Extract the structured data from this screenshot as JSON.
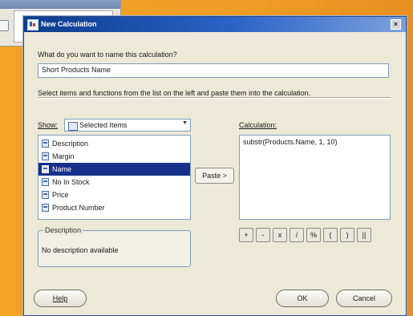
{
  "dialog": {
    "title": "New Calculation",
    "close_glyph": "×",
    "name_prompt": "What do you want to name this calculation?",
    "name_value": "Short Products Name",
    "instructions": "Select items and functions from the list on the left and paste them into the calculation.",
    "show_label": "Show:",
    "show_value": "Selected Items",
    "items": [
      {
        "label": "Description",
        "selected": false
      },
      {
        "label": "Margin",
        "selected": false
      },
      {
        "label": "Name",
        "selected": true
      },
      {
        "label": "No In Stock",
        "selected": false
      },
      {
        "label": "Price",
        "selected": false
      },
      {
        "label": "Product Number",
        "selected": false
      }
    ],
    "paste_label": "Paste >",
    "calculation_label": "Calculation:",
    "calculation_value": "substr(Products.Name, 1, 10)",
    "operators": [
      "+",
      "-",
      "x",
      "/",
      "%",
      "(",
      ")",
      "||"
    ],
    "description_legend": "Description",
    "description_text": "No description available",
    "help_label": "Help",
    "ok_label": "OK",
    "cancel_label": "Cancel"
  },
  "colors": {
    "background": "#f0a024",
    "title_bar": "#0b3b8c",
    "selection": "#17318a",
    "dialog_face": "#ece9d8"
  },
  "icons": {
    "title": "calculation-icon",
    "show": "folder-icon",
    "item": "item-icon"
  }
}
